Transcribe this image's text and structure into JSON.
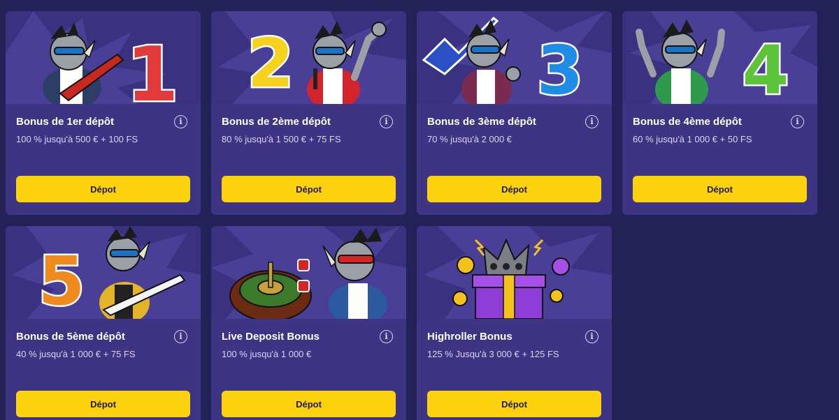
{
  "bonuses": [
    {
      "title": "Bonus de 1er dépôt",
      "desc": "100 % jusqu'à 500 € + 100 FS",
      "number": "1",
      "number_color": "#e23a3a",
      "button": "Dépot"
    },
    {
      "title": "Bonus de 2ème dépôt",
      "desc": "80 % jusqu'à 1 500 € + 75 FS",
      "number": "2",
      "number_color": "#f4d21d",
      "button": "Dépot"
    },
    {
      "title": "Bonus de 3ème dépôt",
      "desc": "70 % jusqu'à 2 000 €",
      "number": "3",
      "number_color": "#1f8de8",
      "button": "Dépot"
    },
    {
      "title": "Bonus de 4ème dépôt",
      "desc": "60 % jusqu'à 1 000 € + 50 FS",
      "number": "4",
      "number_color": "#5cc43a",
      "button": "Dépot"
    },
    {
      "title": "Bonus de 5ème dépôt",
      "desc": "40 % jusqu'à 1 000 € + 75 FS",
      "number": "5",
      "number_color": "#f08a1c",
      "button": "Dépot"
    },
    {
      "title": "Live Deposit Bonus",
      "desc": "100 % jusqu'à 1 000 €",
      "button": "Dépot"
    },
    {
      "title": "Highroller Bonus",
      "desc": "125 % Jusqu'à 3 000 € + 125 FS",
      "button": "Dépot"
    }
  ],
  "icons": {
    "info": "info-icon"
  },
  "colors": {
    "page_bg": "#242058",
    "card_bg": "#3d3484",
    "button_bg": "#fcd10d"
  }
}
